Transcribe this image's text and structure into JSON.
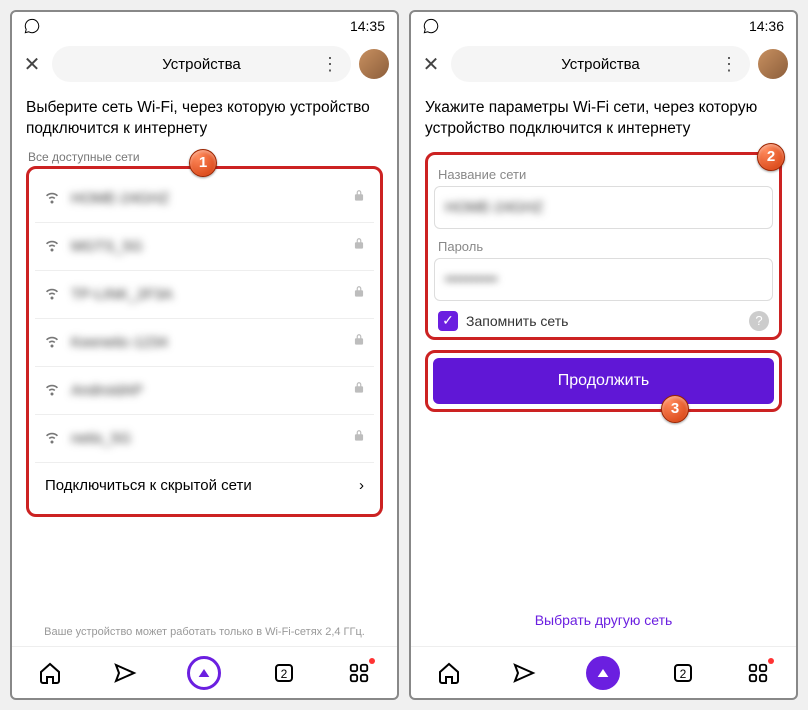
{
  "left": {
    "status_time": "14:35",
    "topbar_title": "Устройства",
    "heading": "Выберите сеть Wi-Fi, через которую устройство подключится к интернету",
    "section_label": "Все доступные сети",
    "networks": [
      {
        "name": "HOME-24GHZ",
        "locked": true
      },
      {
        "name": "MGTS_5G",
        "locked": true
      },
      {
        "name": "TP-LINK_2F3A",
        "locked": true
      },
      {
        "name": "Keenetic-1234",
        "locked": true
      },
      {
        "name": "AndroidAP",
        "locked": true
      },
      {
        "name": "netis_5G",
        "locked": true
      }
    ],
    "hidden_label": "Подключиться к скрытой сети",
    "footnote": "Ваше устройство может работать только в Wi-Fi-сетях 2,4 ГГц.",
    "badge": "1"
  },
  "right": {
    "status_time": "14:36",
    "topbar_title": "Устройства",
    "heading": "Укажите параметры Wi-Fi сети, через которую устройство подключится к интернету",
    "label_ssid": "Название сети",
    "value_ssid": "HOME-24GHZ",
    "label_password": "Пароль",
    "value_password": "••••••••••",
    "remember_label": "Запомнить сеть",
    "cta_label": "Продолжить",
    "alt_link": "Выбрать другую сеть",
    "badge_form": "2",
    "badge_cta": "3"
  }
}
